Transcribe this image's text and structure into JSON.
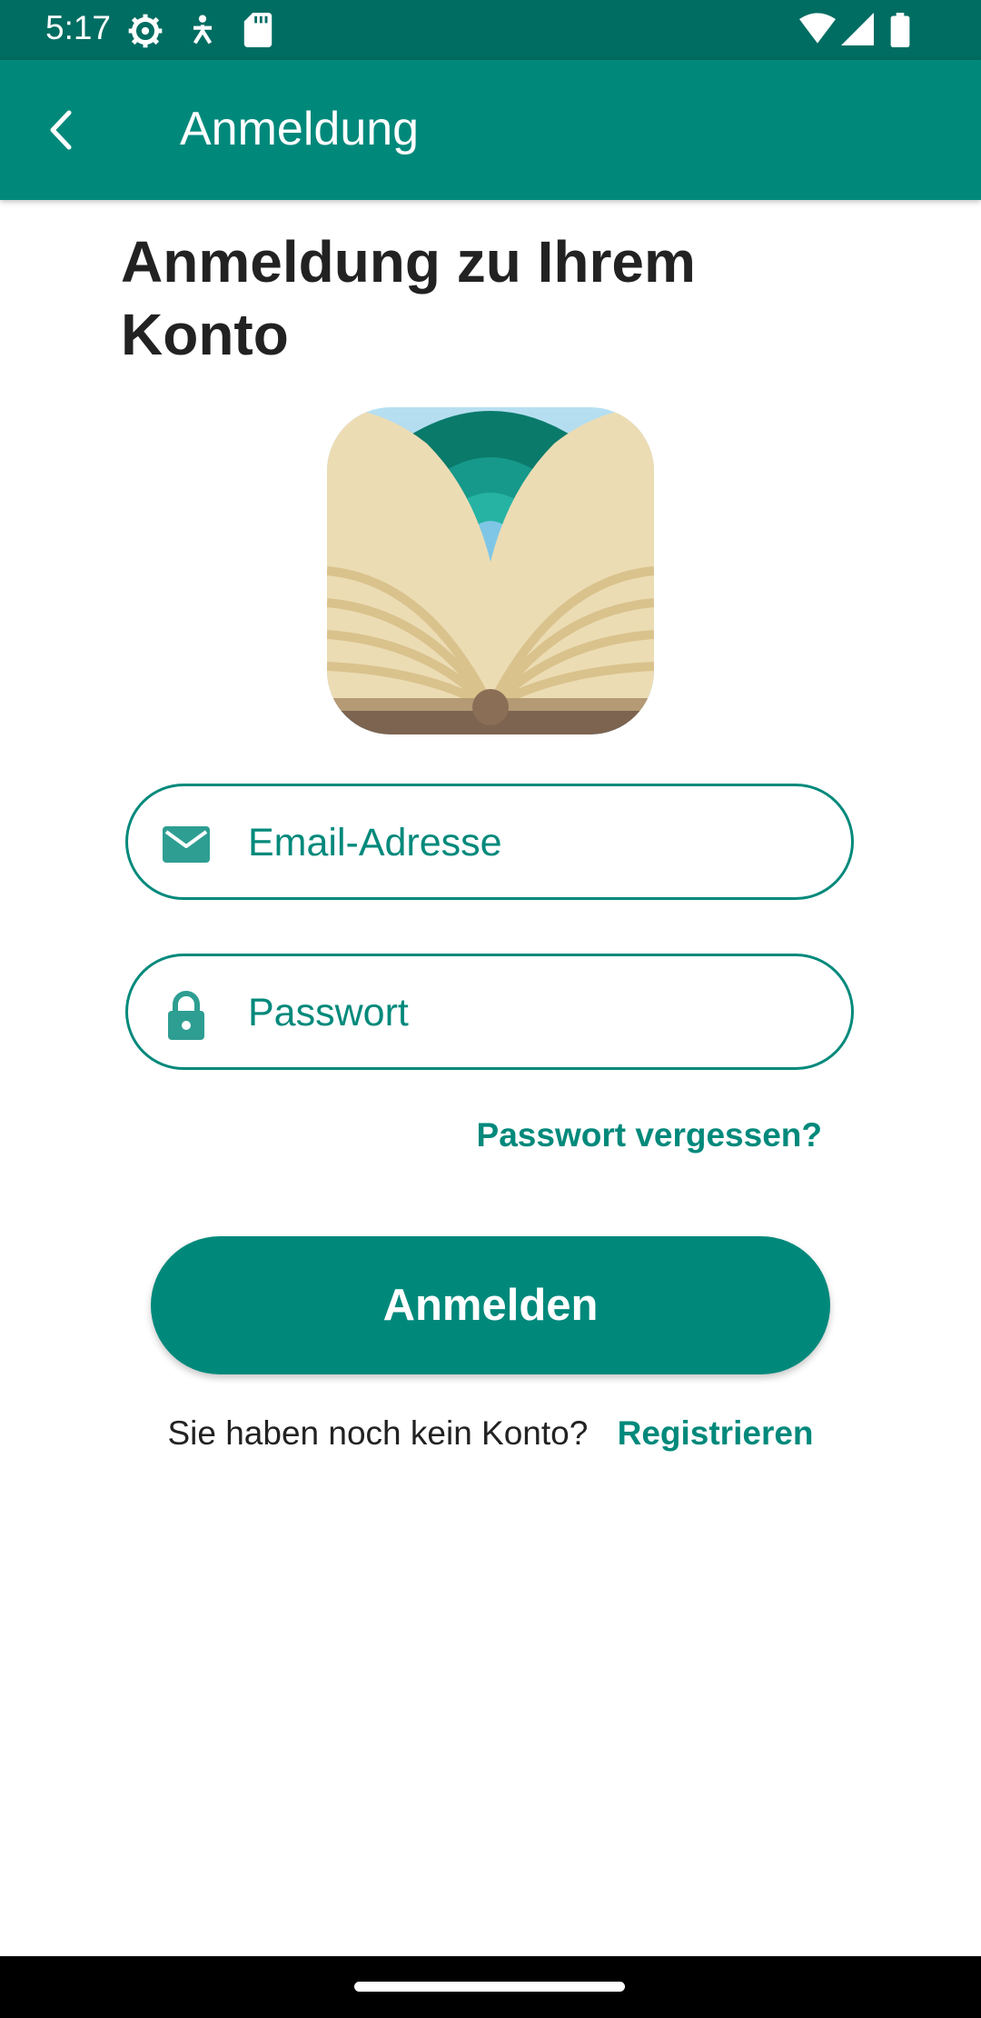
{
  "status_bar": {
    "time": "5:17",
    "left_icons": [
      "settings-gear-icon",
      "accessibility-icon",
      "sd-card-icon"
    ],
    "right_icons": [
      "wifi-icon",
      "cellular-signal-icon",
      "battery-icon"
    ]
  },
  "app_bar": {
    "title": "Anmeldung",
    "back_icon": "chevron-left-icon"
  },
  "main": {
    "heading": "Anmeldung zu Ihrem Konto",
    "logo": "book-wifi-app-logo"
  },
  "form": {
    "email": {
      "placeholder": "Email-Adresse",
      "value": "",
      "icon": "email-icon"
    },
    "password": {
      "placeholder": "Passwort",
      "value": "",
      "icon": "lock-icon"
    },
    "forgot_password": "Passwort vergessen?",
    "login_button": "Anmelden",
    "no_account_text": "Sie haben noch kein Konto?",
    "register_link": "Registrieren"
  },
  "colors": {
    "primary": "#00897b",
    "status_bar": "#006d62",
    "heading_text": "#222222"
  }
}
